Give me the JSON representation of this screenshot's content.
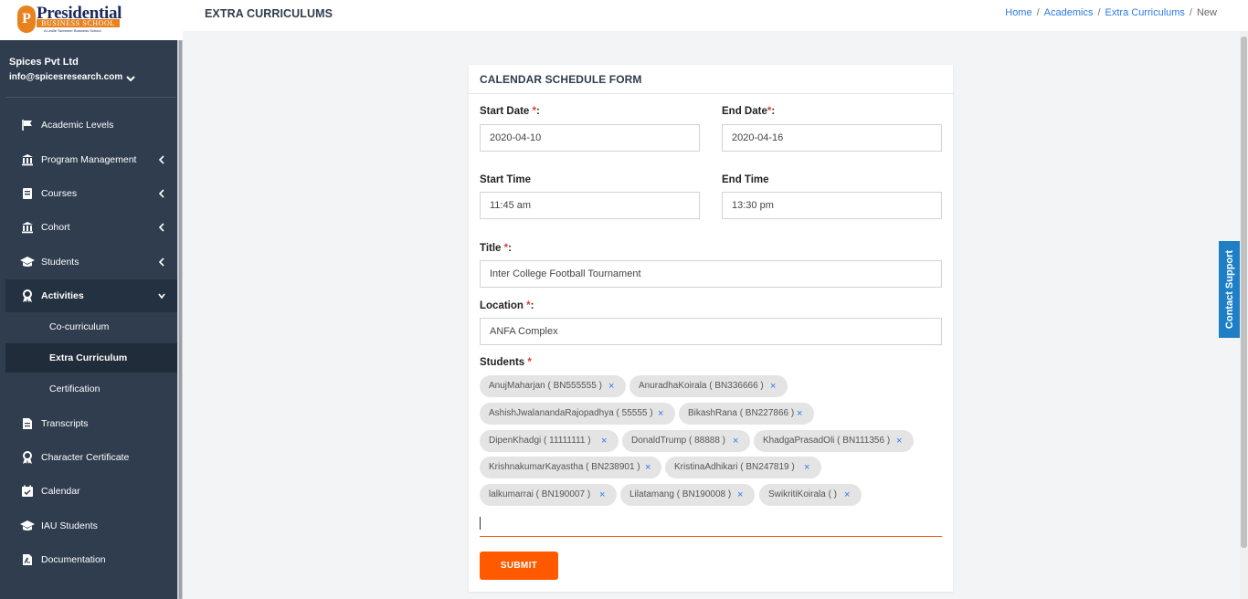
{
  "sidebar": {
    "logo": {
      "name": "Presidential",
      "sub": "BUSINESS SCHOOL",
      "tag": "A Leslie Swimmer Business School",
      "mark": "P"
    },
    "user": {
      "name": "Spices Pvt Ltd",
      "email": "info@spicesresearch.com"
    },
    "items": [
      {
        "label": "Academic Levels",
        "icon": "flag-icon"
      },
      {
        "label": "Program Management",
        "icon": "bank-icon"
      },
      {
        "label": "Courses",
        "icon": "book-icon"
      },
      {
        "label": "Cohort",
        "icon": "bank-icon"
      },
      {
        "label": "Students",
        "icon": "graduation-cap-icon"
      },
      {
        "label": "Activities",
        "icon": "award-icon"
      },
      {
        "label": "Transcripts",
        "icon": "file-icon"
      },
      {
        "label": "Character Certificate",
        "icon": "award-icon"
      },
      {
        "label": "Calendar",
        "icon": "calendar-check-icon"
      },
      {
        "label": "IAU Students",
        "icon": "graduation-cap-icon"
      },
      {
        "label": "Documentation",
        "icon": "pdf-file-icon"
      }
    ],
    "subitems": [
      {
        "label": "Co-curriculum"
      },
      {
        "label": "Extra Curriculum"
      },
      {
        "label": "Certification"
      }
    ]
  },
  "header": {
    "title": "EXTRA CURRICULUMS",
    "breadcrumb": [
      "Home",
      "Academics",
      "Extra Curriculums",
      "New"
    ]
  },
  "form": {
    "title": "CALENDAR SCHEDULE FORM",
    "start_date": {
      "label": "Start Date",
      "required": "*",
      "suffix": ":",
      "value": "2020-04-10"
    },
    "end_date": {
      "label": "End Date",
      "required": "*",
      "suffix": ":",
      "value": "2020-04-16"
    },
    "start_time": {
      "label": "Start Time",
      "value": "11:45 am"
    },
    "end_time": {
      "label": "End Time",
      "value": "13:30 pm"
    },
    "title_field": {
      "label": "Title ",
      "required": "*",
      "suffix": ":",
      "value": "Inter College Football Tournament"
    },
    "location": {
      "label": "Location ",
      "required": "*",
      "suffix": ":",
      "value": "ANFA Complex"
    },
    "students": {
      "label": "Students ",
      "required": "*",
      "remove_symbol": "×",
      "chips": [
        "AnujMaharjan ( BN555555 )",
        "AnuradhaKoirala ( BN336666 )",
        "AshishJwalanandaRajopadhya ( 55555 )",
        "BikashRana ( BN227866 )",
        "DipenKhadgi ( 11111111 )",
        "DonaldTrump ( 88888 )",
        "KhadgaPrasadOli ( BN111356 )",
        "KrishnakumarKayastha ( BN238901 )",
        "KristinaAdhikari ( BN247819 )",
        "lalkumarrai ( BN190007 )",
        "Lilatamang ( BN190008 )",
        "SwikritiKoirala ( )"
      ]
    },
    "submit_label": "SUBMIT"
  },
  "support_tab": "Contact Support",
  "colors": {
    "sidebar": "#2f3d4e",
    "accent": "#ff5a00",
    "link": "#2c7be5",
    "required": "#e53935"
  }
}
